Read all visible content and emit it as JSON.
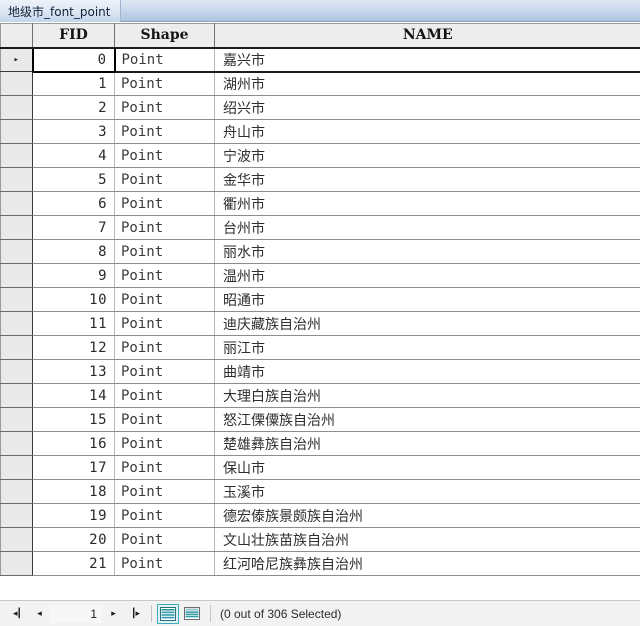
{
  "window": {
    "tab_title": "地级市_font_point"
  },
  "table": {
    "columns": [
      {
        "key": "selector",
        "label": ""
      },
      {
        "key": "fid",
        "label": "FID"
      },
      {
        "key": "shape",
        "label": "Shape"
      },
      {
        "key": "name",
        "label": "NAME"
      }
    ],
    "rows": [
      {
        "fid": "0",
        "shape": "Point",
        "name": "嘉兴市"
      },
      {
        "fid": "1",
        "shape": "Point",
        "name": "湖州市"
      },
      {
        "fid": "2",
        "shape": "Point",
        "name": "绍兴市"
      },
      {
        "fid": "3",
        "shape": "Point",
        "name": "舟山市"
      },
      {
        "fid": "4",
        "shape": "Point",
        "name": "宁波市"
      },
      {
        "fid": "5",
        "shape": "Point",
        "name": "金华市"
      },
      {
        "fid": "6",
        "shape": "Point",
        "name": "衢州市"
      },
      {
        "fid": "7",
        "shape": "Point",
        "name": "台州市"
      },
      {
        "fid": "8",
        "shape": "Point",
        "name": "丽水市"
      },
      {
        "fid": "9",
        "shape": "Point",
        "name": "温州市"
      },
      {
        "fid": "10",
        "shape": "Point",
        "name": "昭通市"
      },
      {
        "fid": "11",
        "shape": "Point",
        "name": "迪庆藏族自治州"
      },
      {
        "fid": "12",
        "shape": "Point",
        "name": "丽江市"
      },
      {
        "fid": "13",
        "shape": "Point",
        "name": "曲靖市"
      },
      {
        "fid": "14",
        "shape": "Point",
        "name": "大理白族自治州"
      },
      {
        "fid": "15",
        "shape": "Point",
        "name": "怒江傈僳族自治州"
      },
      {
        "fid": "16",
        "shape": "Point",
        "name": "楚雄彝族自治州"
      },
      {
        "fid": "17",
        "shape": "Point",
        "name": "保山市"
      },
      {
        "fid": "18",
        "shape": "Point",
        "name": "玉溪市"
      },
      {
        "fid": "19",
        "shape": "Point",
        "name": "德宏傣族景颇族自治州"
      },
      {
        "fid": "20",
        "shape": "Point",
        "name": "文山壮族苗族自治州"
      },
      {
        "fid": "21",
        "shape": "Point",
        "name": "红河哈尼族彝族自治州"
      }
    ],
    "current_row_index": 0,
    "row_marker_glyph": "▸"
  },
  "statusbar": {
    "first_glyph": "◂┃",
    "prev_glyph": "◂",
    "next_glyph": "▸",
    "last_glyph": "┃▸",
    "page_value": "1",
    "view_table_icon": "table-view-icon",
    "view_form_icon": "form-view-icon",
    "selection_text": "(0 out of 306 Selected)"
  },
  "colors": {
    "tab_accent": "#aec4e0",
    "header_bg": "#ededed",
    "view_active_border": "#3fa9b8",
    "icon_teal": "#2f9aa8"
  }
}
